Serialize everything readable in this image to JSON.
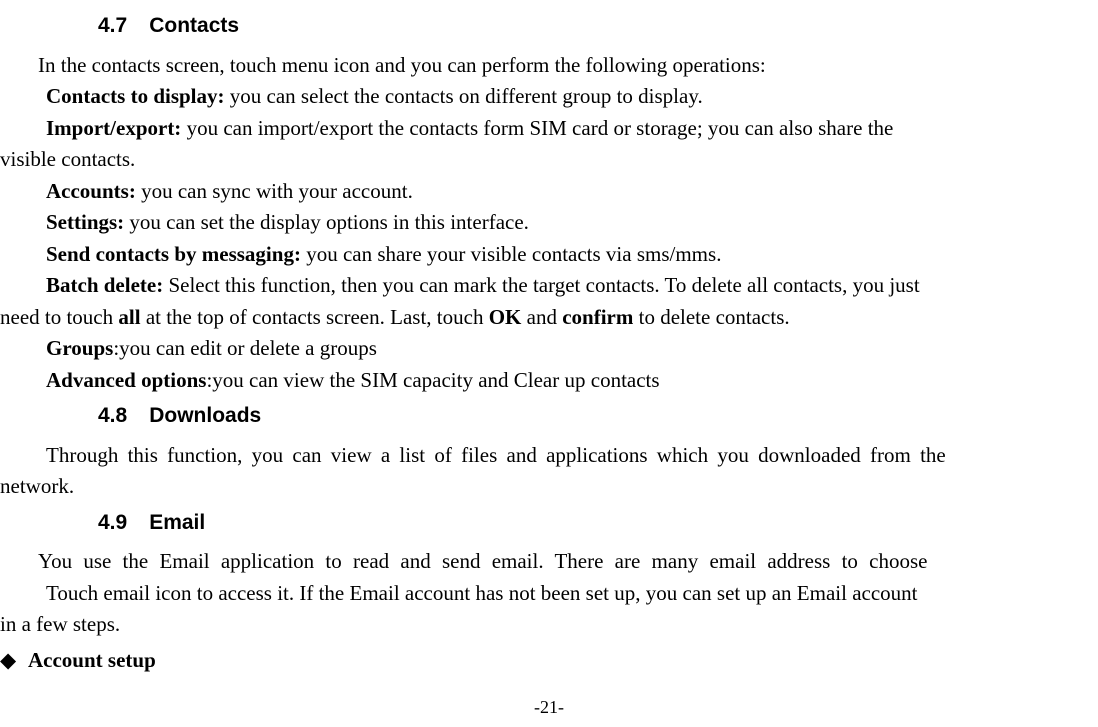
{
  "sections": {
    "s47": {
      "num": "4.7",
      "title": "Contacts",
      "intro": "In the contacts screen, touch menu icon and you can perform the following operations:",
      "items": {
        "contacts_to_display": {
          "label": "Contacts to display:",
          "text": " you can select the contacts on different group to display."
        },
        "import_export": {
          "label": "Import/export:",
          "text_a": " you can import/export the contacts form SIM card or storage; you can also share the ",
          "text_b": "visible contacts."
        },
        "accounts": {
          "label": "Accounts:",
          "text": " you can sync with your account."
        },
        "settings": {
          "label": "Settings:",
          "text": " you can set the display options in this interface."
        },
        "send_msg": {
          "label": "Send contacts by messaging:",
          "text": " you can share your visible contacts via sms/mms."
        },
        "batch_delete": {
          "label": "Batch delete: ",
          "text_a": "Select this function, then you can mark the target contacts. To delete all contacts, you just ",
          "text_b_pre": "need to touch ",
          "all": "all",
          "text_b_mid": " at the top of contacts screen. Last, touch ",
          "ok": "OK",
          "and": " and ",
          "confirm": "confirm",
          "text_b_post": " to delete contacts."
        },
        "groups": {
          "label": "Groups",
          "text": ":you can edit or delete a groups"
        },
        "advanced": {
          "label": "Advanced options",
          "text": ":you can view the SIM capacity and Clear up contacts"
        }
      }
    },
    "s48": {
      "num": "4.8",
      "title": "Downloads",
      "body_a": "Through this function, you can view a list of files and applications which you downloaded from the ",
      "body_b": "network."
    },
    "s49": {
      "num": "4.9",
      "title": "Email",
      "line1": "You use the Email application to read and send email. There are many email address to choose",
      "line2_a": "Touch email icon to access it. If the Email account has not been set up, you can set up an Email account ",
      "line2_b": "in a few steps.",
      "bullet": {
        "diamond": "◆",
        "label": "Account setup"
      }
    }
  },
  "page_number": "-21-"
}
